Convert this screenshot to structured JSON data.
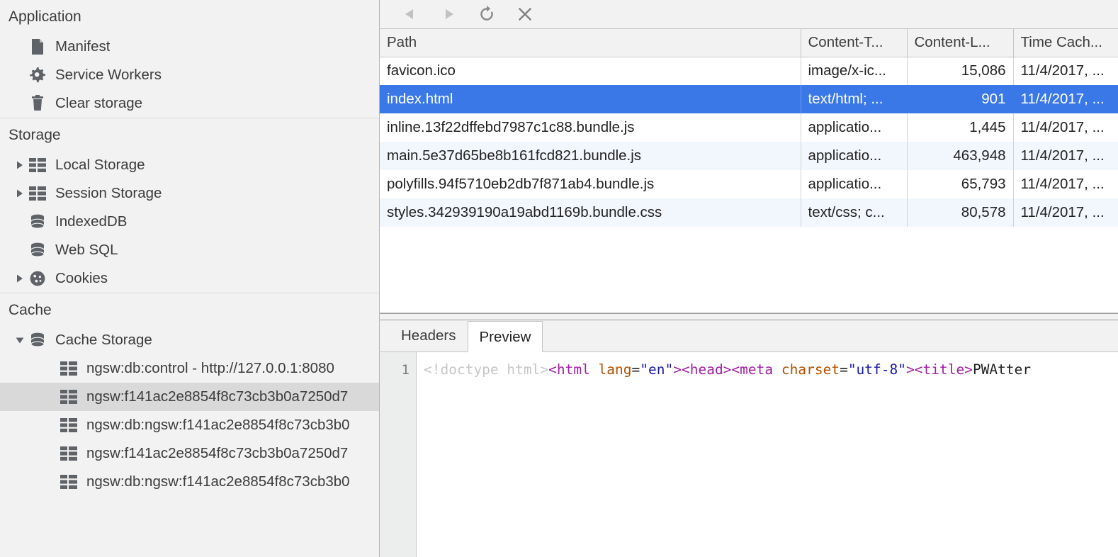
{
  "sidebar": {
    "sections": [
      {
        "title": "Application",
        "items": [
          {
            "label": "Manifest",
            "icon": "document-icon",
            "expander": "none",
            "selected": false
          },
          {
            "label": "Service Workers",
            "icon": "gear-icon",
            "expander": "none",
            "selected": false
          },
          {
            "label": "Clear storage",
            "icon": "trash-icon",
            "expander": "none",
            "selected": false
          }
        ]
      },
      {
        "title": "Storage",
        "items": [
          {
            "label": "Local Storage",
            "icon": "table-icon",
            "expander": "collapsed",
            "selected": false
          },
          {
            "label": "Session Storage",
            "icon": "table-icon",
            "expander": "collapsed",
            "selected": false
          },
          {
            "label": "IndexedDB",
            "icon": "database-icon",
            "expander": "none",
            "selected": false
          },
          {
            "label": "Web SQL",
            "icon": "database-icon",
            "expander": "none",
            "selected": false
          },
          {
            "label": "Cookies",
            "icon": "cookie-icon",
            "expander": "collapsed",
            "selected": false
          }
        ]
      },
      {
        "title": "Cache",
        "items": [
          {
            "label": "Cache Storage",
            "icon": "database-icon",
            "expander": "expanded",
            "selected": false
          },
          {
            "label": "ngsw:db:control - http://127.0.0.1:8080",
            "icon": "table-icon",
            "expander": "none",
            "selected": false,
            "deep": true
          },
          {
            "label": "ngsw:f141ac2e8854f8c73cb3b0a7250d7",
            "icon": "table-icon",
            "expander": "none",
            "selected": true,
            "deep": true
          },
          {
            "label": "ngsw:db:ngsw:f141ac2e8854f8c73cb3b0",
            "icon": "table-icon",
            "expander": "none",
            "selected": false,
            "deep": true
          },
          {
            "label": "ngsw:f141ac2e8854f8c73cb3b0a7250d7",
            "icon": "table-icon",
            "expander": "none",
            "selected": false,
            "deep": true
          },
          {
            "label": "ngsw:db:ngsw:f141ac2e8854f8c73cb3b0",
            "icon": "table-icon",
            "expander": "none",
            "selected": false,
            "deep": true
          }
        ]
      }
    ]
  },
  "toolbar": {
    "back_label": "Back",
    "forward_label": "Forward",
    "refresh_label": "Refresh",
    "delete_label": "Delete Selected"
  },
  "table": {
    "columns": [
      "Path",
      "Content-T...",
      "Content-L...",
      "Time Cach..."
    ],
    "rows": [
      {
        "path": "favicon.ico",
        "content_type": "image/x-ic...",
        "content_length": "15,086",
        "time_cached": "11/4/2017, ...",
        "selected": false
      },
      {
        "path": "index.html",
        "content_type": "text/html; ...",
        "content_length": "901",
        "time_cached": "11/4/2017, ...",
        "selected": true
      },
      {
        "path": "inline.13f22dffebd7987c1c88.bundle.js",
        "content_type": "applicatio...",
        "content_length": "1,445",
        "time_cached": "11/4/2017, ...",
        "selected": false
      },
      {
        "path": "main.5e37d65be8b161fcd821.bundle.js",
        "content_type": "applicatio...",
        "content_length": "463,948",
        "time_cached": "11/4/2017, ...",
        "selected": false
      },
      {
        "path": "polyfills.94f5710eb2db7f871ab4.bundle.js",
        "content_type": "applicatio...",
        "content_length": "65,793",
        "time_cached": "11/4/2017, ...",
        "selected": false
      },
      {
        "path": "styles.342939190a19abd1169b.bundle.css",
        "content_type": "text/css; c...",
        "content_length": "80,578",
        "time_cached": "11/4/2017, ...",
        "selected": false
      }
    ]
  },
  "detail": {
    "tabs": [
      {
        "label": "Headers",
        "active": false
      },
      {
        "label": "Preview",
        "active": true
      }
    ],
    "line_number": "1",
    "code_tokens": [
      {
        "text": "<!doctype html>",
        "kind": "doctype"
      },
      {
        "text": "<html",
        "kind": "tag"
      },
      {
        "text": " lang",
        "kind": "attr"
      },
      {
        "text": "=",
        "kind": "eq"
      },
      {
        "text": "\"en\"",
        "kind": "val"
      },
      {
        "text": ">",
        "kind": "tag"
      },
      {
        "text": "<head>",
        "kind": "tag"
      },
      {
        "text": "<meta",
        "kind": "tag"
      },
      {
        "text": " charset",
        "kind": "attr"
      },
      {
        "text": "=",
        "kind": "eq"
      },
      {
        "text": "\"utf-8\"",
        "kind": "val"
      },
      {
        "text": ">",
        "kind": "tag"
      },
      {
        "text": "<title>",
        "kind": "tag"
      },
      {
        "text": "PWAtter",
        "kind": "text"
      }
    ]
  },
  "colors": {
    "selection_blue": "#3b78e7",
    "sidebar_bg": "#f2f2f2",
    "sidebar_selected": "#d9d9d9",
    "row_alt": "#f2f7fd",
    "icon_gray": "#5f6368"
  }
}
